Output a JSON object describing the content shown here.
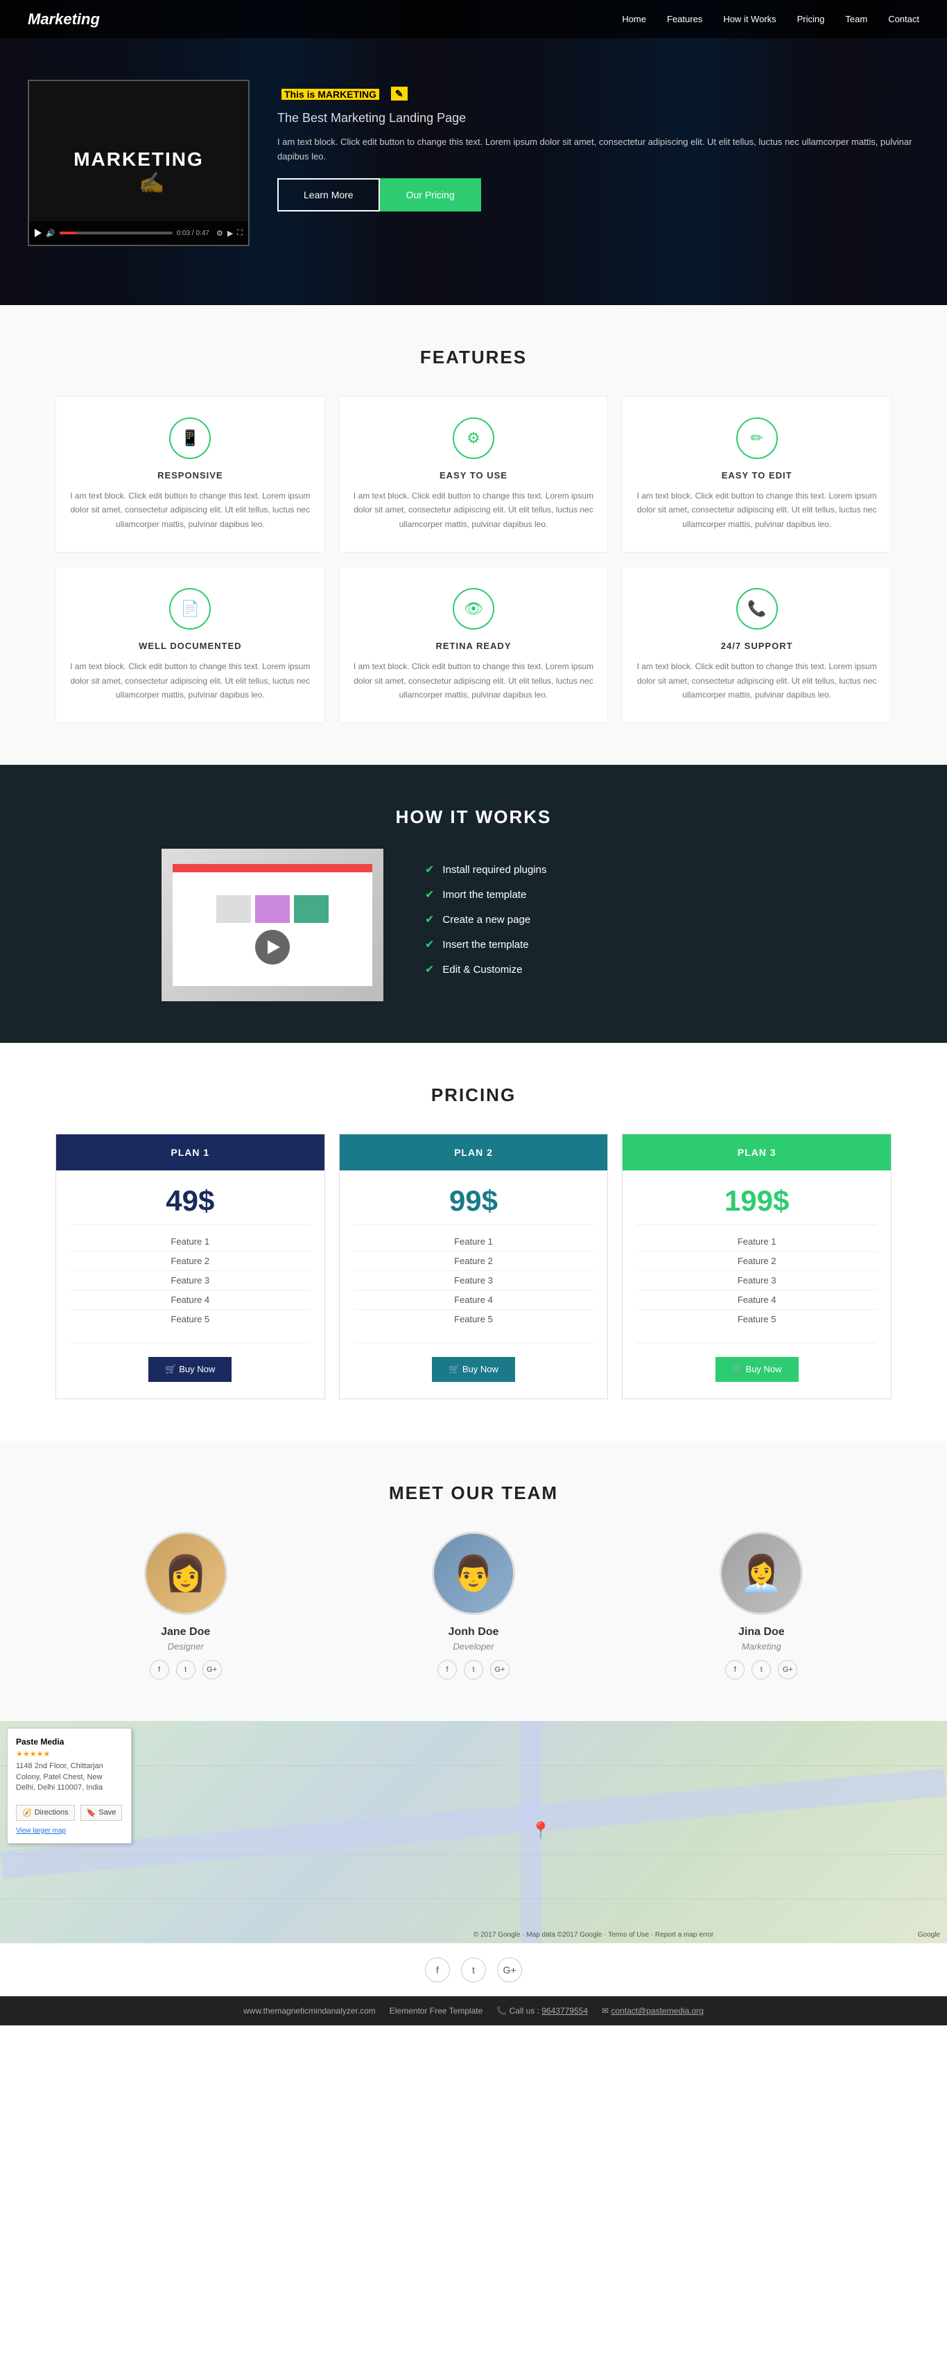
{
  "nav": {
    "brand": "Marketing",
    "links": [
      "Home",
      "Features",
      "How it Works",
      "Pricing",
      "Team",
      "Contact"
    ]
  },
  "hero": {
    "video_title": "MARKETING",
    "time_current": "0:03",
    "time_total": "0:47",
    "heading": "This is MARKETING",
    "badge": "✎",
    "subheading": "The Best Marketing Landing Page",
    "description": "I am text block. Click edit button to change this text. Lorem ipsum dolor sit amet, consectetur adipiscing elit. Ut elit tellus, luctus nec ullamcorper mattis, pulvinar dapibus leo.",
    "btn_learn": "Learn More",
    "btn_pricing": "Our Pricing"
  },
  "features": {
    "section_title": "FEATURES",
    "cards": [
      {
        "icon": "📱",
        "title": "RESPONSIVE",
        "desc": "I am text block. Click edit button to change this text. Lorem ipsum dolor sit amet, consectetur adipiscing elit. Ut elit tellus, luctus nec ullamcorper mattis, pulvinar dapibus leo."
      },
      {
        "icon": "⚙",
        "title": "EASY TO USE",
        "desc": "I am text block. Click edit button to change this text. Lorem ipsum dolor sit amet, consectetur adipiscing elit. Ut elit tellus, luctus nec ullamcorper mattis, pulvinar dapibus leo."
      },
      {
        "icon": "✏",
        "title": "EASY TO EDIT",
        "desc": "I am text block. Click edit button to change this text. Lorem ipsum dolor sit amet, consectetur adipiscing elit. Ut elit tellus, luctus nec ullamcorper mattis, pulvinar dapibus leo."
      },
      {
        "icon": "📄",
        "title": "WELL DOCUMENTED",
        "desc": "I am text block. Click edit button to change this text. Lorem ipsum dolor sit amet, consectetur adipiscing elit. Ut elit tellus, luctus nec ullamcorper mattis, pulvinar dapibus leo."
      },
      {
        "icon": "👁",
        "title": "RETINA READY",
        "desc": "I am text block. Click edit button to change this text. Lorem ipsum dolor sit amet, consectetur adipiscing elit. Ut elit tellus, luctus nec ullamcorper mattis, pulvinar dapibus leo."
      },
      {
        "icon": "📞",
        "title": "24/7 SUPPORT",
        "desc": "I am text block. Click edit button to change this text. Lorem ipsum dolor sit amet, consectetur adipiscing elit. Ut elit tellus, luctus nec ullamcorper mattis, pulvinar dapibus leo."
      }
    ]
  },
  "how_it_works": {
    "section_title": "HOW IT WORKS",
    "steps": [
      "Install required plugins",
      "Imort the template",
      "Create a new page",
      "Insert the template",
      "Edit & Customize"
    ]
  },
  "pricing": {
    "section_title": "PRICING",
    "plans": [
      {
        "name": "PLAN 1",
        "price": "49$",
        "features": [
          "Feature 1",
          "Feature 2",
          "Feature 3",
          "Feature 4",
          "Feature 5"
        ],
        "btn": "Buy Now",
        "header_class": "plan1-header",
        "price_class": "plan1-price",
        "btn_class": "plan1-buy"
      },
      {
        "name": "PLAN 2",
        "price": "99$",
        "features": [
          "Feature 1",
          "Feature 2",
          "Feature 3",
          "Feature 4",
          "Feature 5"
        ],
        "btn": "Buy Now",
        "header_class": "plan2-header",
        "price_class": "plan2-price",
        "btn_class": "plan2-buy"
      },
      {
        "name": "PLAN 3",
        "price": "199$",
        "features": [
          "Feature 1",
          "Feature 2",
          "Feature 3",
          "Feature 4",
          "Feature 5"
        ],
        "btn": "Buy Now",
        "header_class": "plan3-header",
        "price_class": "plan3-price",
        "btn_class": "plan3-buy"
      }
    ]
  },
  "team": {
    "section_title": "MEET OUR TEAM",
    "members": [
      {
        "name": "Jane Doe",
        "role": "Designer",
        "avatar_class": "avatar1",
        "emoji": "👩"
      },
      {
        "name": "Jonh Doe",
        "role": "Developer",
        "avatar_class": "avatar2",
        "emoji": "👨"
      },
      {
        "name": "Jina Doe",
        "role": "Marketing",
        "avatar_class": "avatar3",
        "emoji": "👩‍💼"
      }
    ]
  },
  "map": {
    "company": "Paste Media",
    "address": "1148 2nd Floor, Chittarjan Colony, Patel Chest, New Delhi, Delhi 110007, India",
    "link": "View larger map",
    "directions_btn": "Directions",
    "save_btn": "Save",
    "stars": "★★★★★"
  },
  "footer": {
    "template_label": "Elementor Free Template",
    "phone_label": "Call us :",
    "phone": "9643779554",
    "email": "contact@pastemedia.org",
    "website": "www.themagneticmindanalyzer.com",
    "social_icons": [
      "f",
      "t",
      "G+"
    ]
  }
}
